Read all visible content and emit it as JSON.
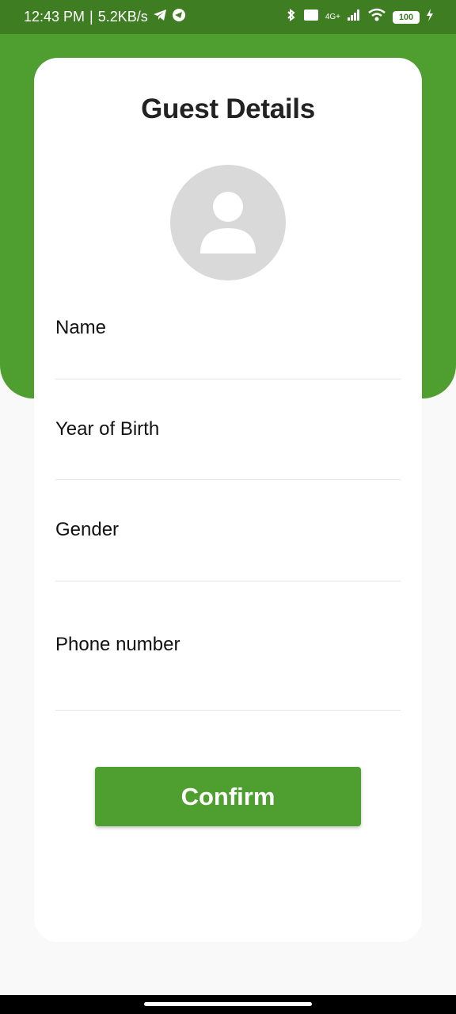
{
  "status_bar": {
    "time": "12:43 PM",
    "separator": "|",
    "speed": "5.2KB/s",
    "icons": [
      "telegram-icon",
      "telegram-icon",
      "bluetooth-icon",
      "volte-icon",
      "signal-icon",
      "wifi-icon",
      "battery-icon",
      "charging-icon"
    ],
    "network": "4G+",
    "battery": "100"
  },
  "page": {
    "title": "Guest Details",
    "avatar_icon": "person-icon"
  },
  "form": {
    "fields": [
      {
        "label": "Name",
        "value": "",
        "placeholder": ""
      },
      {
        "label": "Year of Birth",
        "value": "",
        "placeholder": ""
      },
      {
        "label": "Gender",
        "value": "",
        "placeholder": ""
      },
      {
        "label": "Phone number",
        "value": "",
        "placeholder": ""
      }
    ],
    "confirm_label": "Confirm"
  },
  "colors": {
    "primary": "#4f9e30",
    "status_bar": "#3f7d23",
    "avatar_bg": "#d9d9d9",
    "background": "#f9f9f9"
  }
}
